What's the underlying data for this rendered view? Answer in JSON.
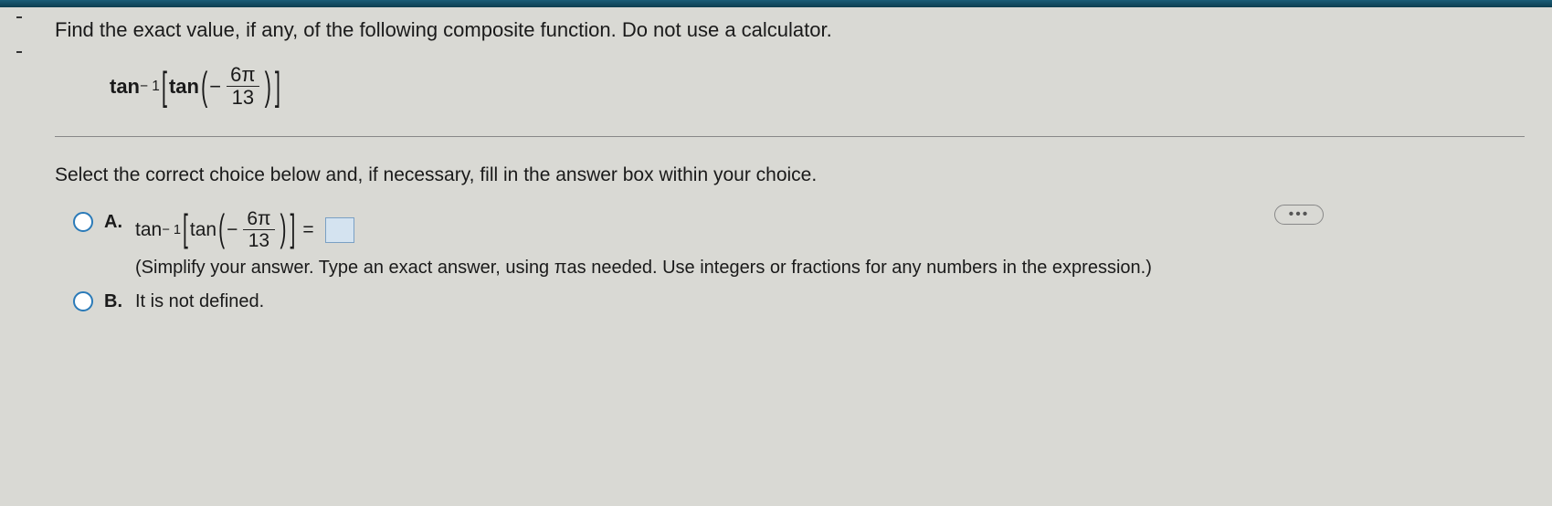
{
  "prompt": "Find the exact value, if any, of the following composite function. Do not use a calculator.",
  "expression": {
    "outer": "tan",
    "outer_exp": "− 1",
    "inner": "tan",
    "neg": "−",
    "num": "6π",
    "den": "13"
  },
  "instructions": "Select the correct choice below and, if necessary, fill in the answer box within your choice.",
  "ellipsis": "•••",
  "choices": {
    "a": {
      "label": "A.",
      "eq": "=",
      "hint": "(Simplify your answer. Type an exact answer, using πas needed. Use integers or fractions for any numbers in the expression.)"
    },
    "b": {
      "label": "B.",
      "text": "It is not defined."
    }
  }
}
